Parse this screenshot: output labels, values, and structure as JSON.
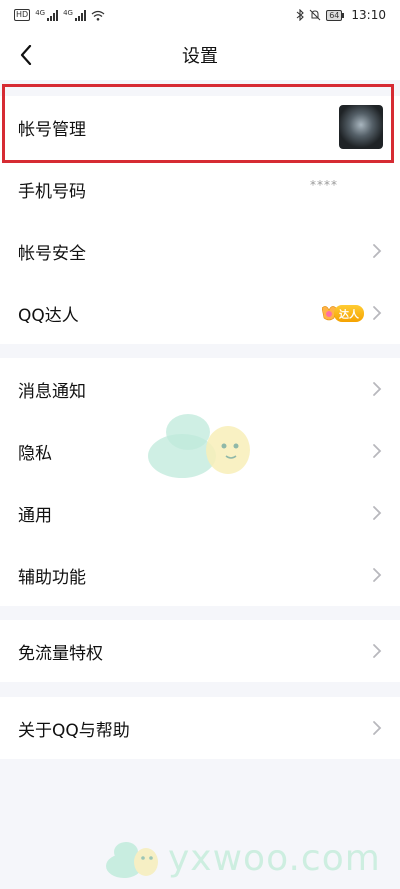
{
  "status_bar": {
    "left_badge": "HD",
    "network_1": "4G",
    "network_2": "4G",
    "battery": "64",
    "time": "13:10"
  },
  "nav": {
    "title": "设置"
  },
  "group1": [
    {
      "label": "帐号管理"
    },
    {
      "label": "手机号码",
      "value": "****"
    },
    {
      "label": "帐号安全"
    },
    {
      "label": "QQ达人",
      "badge": "达人"
    }
  ],
  "group2": [
    {
      "label": "消息通知"
    },
    {
      "label": "隐私"
    },
    {
      "label": "通用"
    },
    {
      "label": "辅助功能"
    }
  ],
  "group3": [
    {
      "label": "免流量特权"
    }
  ],
  "group4": [
    {
      "label": "关于QQ与帮助"
    }
  ],
  "watermark": {
    "text": "yxwoo.com"
  },
  "colors": {
    "highlight": "#d62b33",
    "badge": "#f5a200",
    "background": "#f5f6fa"
  }
}
